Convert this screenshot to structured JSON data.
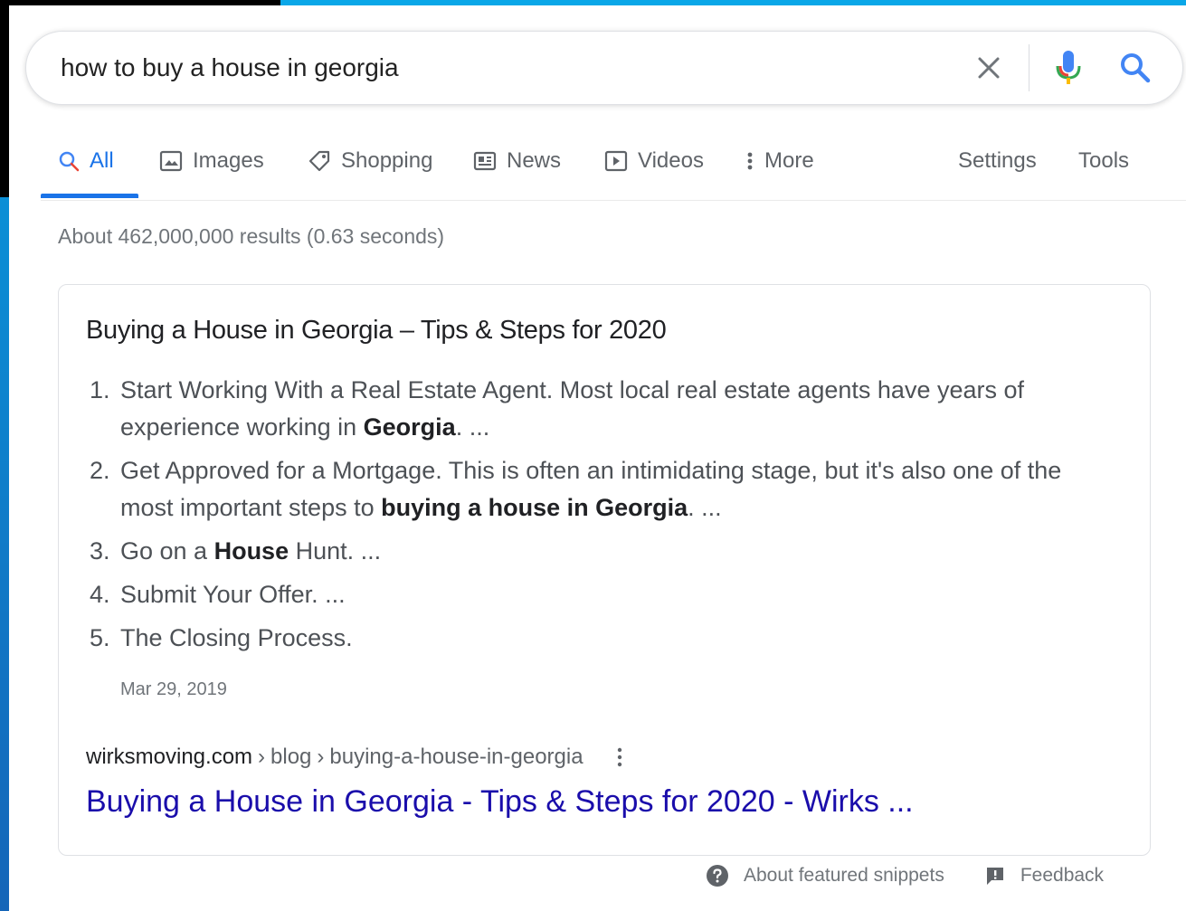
{
  "search": {
    "query": "how to buy a house in georgia"
  },
  "tabs": [
    {
      "label": "All",
      "icon": "search-icon",
      "active": true
    },
    {
      "label": "Images",
      "icon": "image-icon"
    },
    {
      "label": "Shopping",
      "icon": "tag-icon"
    },
    {
      "label": "News",
      "icon": "newspaper-icon"
    },
    {
      "label": "Videos",
      "icon": "play-icon"
    },
    {
      "label": "More",
      "icon": "vertical-dots-icon"
    }
  ],
  "tools": {
    "settings_label": "Settings",
    "tools_label": "Tools"
  },
  "stats": "About 462,000,000 results (0.63 seconds)",
  "snippet": {
    "title": "Buying a House in Georgia – Tips & Steps for 2020",
    "items": [
      {
        "num": "1.",
        "parts": [
          {
            "text": "Start Working With a Real Estate Agent. Most local real estate agents have years of experience working in "
          },
          {
            "text": "Georgia",
            "bold": true
          },
          {
            "text": ". ..."
          }
        ]
      },
      {
        "num": "2.",
        "parts": [
          {
            "text": "Get Approved for a Mortgage. This is often an intimidating stage, but it's also one of the most important steps to "
          },
          {
            "text": "buying a house in Georgia",
            "bold": true
          },
          {
            "text": ". ..."
          }
        ]
      },
      {
        "num": "3.",
        "parts": [
          {
            "text": "Go on a "
          },
          {
            "text": "House",
            "bold": true
          },
          {
            "text": " Hunt. ..."
          }
        ]
      },
      {
        "num": "4.",
        "parts": [
          {
            "text": "Submit Your Offer. ..."
          }
        ]
      },
      {
        "num": "5.",
        "parts": [
          {
            "text": "The Closing Process."
          }
        ]
      }
    ],
    "date": "Mar 29, 2019",
    "cite": {
      "domain": "wirksmoving.com",
      "sep": "›",
      "path1": "blog",
      "path2": "buying-a-house-in-georgia"
    },
    "link_title": "Buying a House in Georgia - Tips & Steps for 2020 - Wirks ..."
  },
  "footer": {
    "about_label": "About featured snippets",
    "feedback_label": "Feedback"
  },
  "colors": {
    "accent": "#1a73e8",
    "link": "#1a0dab",
    "frame_blue": "#0aa7e8"
  }
}
